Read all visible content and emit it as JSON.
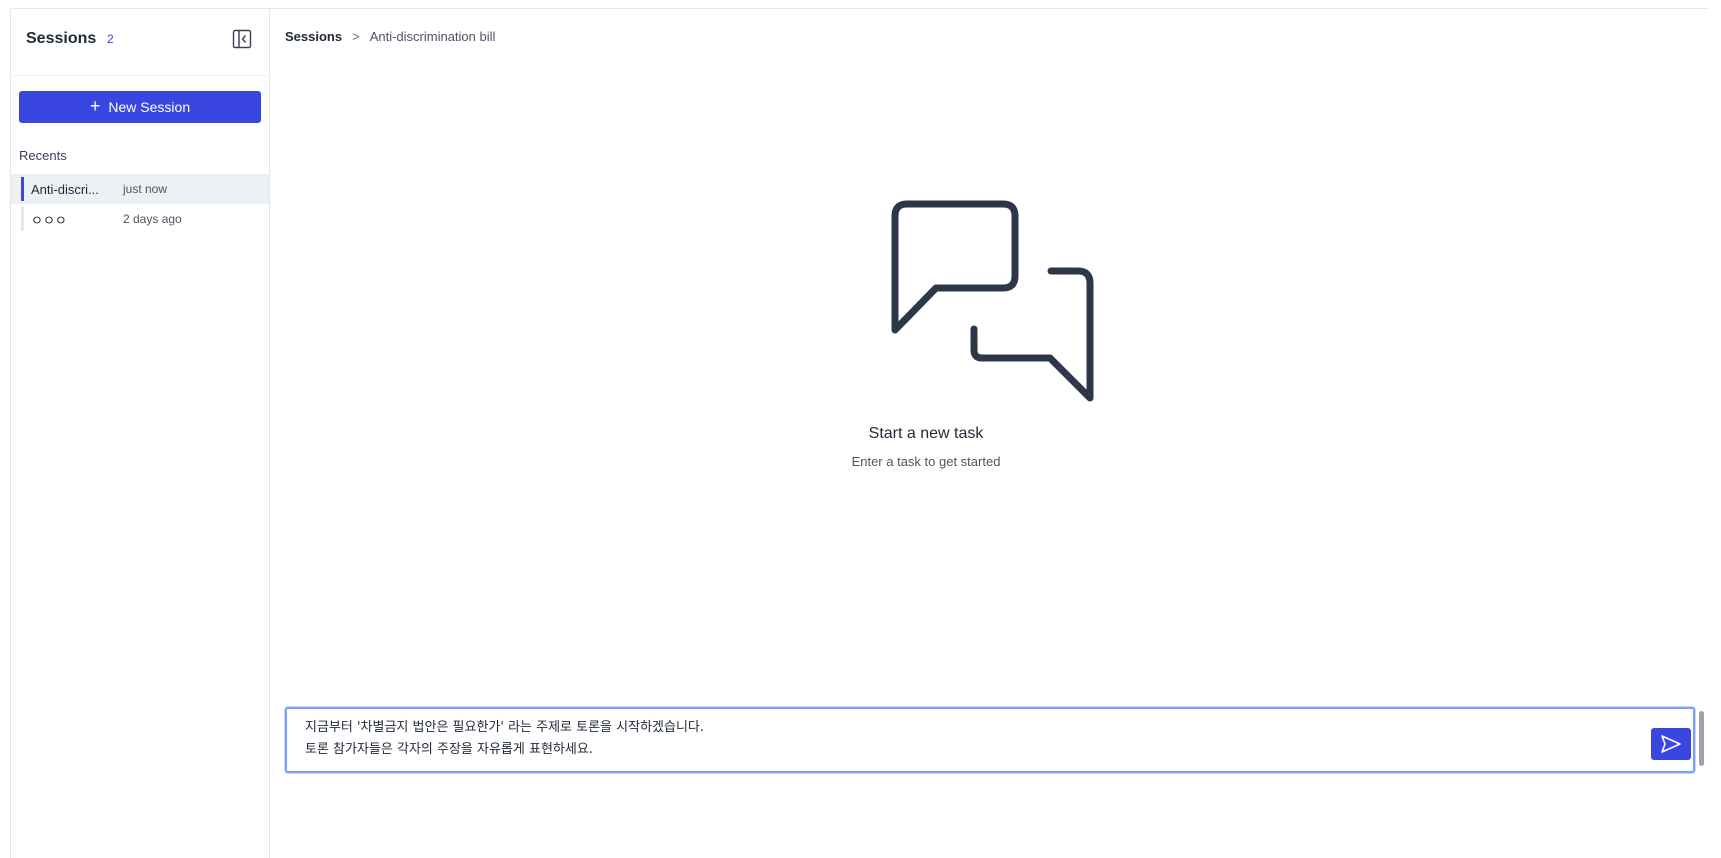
{
  "sidebar": {
    "title": "Sessions",
    "count": "2",
    "new_session_label": "New Session",
    "recents_label": "Recents",
    "items": [
      {
        "name": "Anti-discri...",
        "time": "just now",
        "active": true
      },
      {
        "name": "ㅇㅇㅇ",
        "time": "2 days ago",
        "active": false
      }
    ]
  },
  "breadcrumb": {
    "root": "Sessions",
    "separator": ">",
    "current": "Anti-discrimination bill"
  },
  "empty_state": {
    "icon": "chat-bubbles-icon",
    "title": "Start a new task",
    "subtitle": "Enter a task to get started"
  },
  "composer": {
    "value": "지금부터 '차별금지 법안은 필요한가' 라는 주제로 토론을 시작하겠습니다.\n토론 참가자들은 각자의 주장을 자유롭게 표현하세요.",
    "send_icon": "send-icon"
  },
  "colors": {
    "accent": "#3a46e0",
    "active_row": "#edf0f5",
    "focus_border": "#7aa0f0",
    "icon_stroke": "#2d3748"
  }
}
